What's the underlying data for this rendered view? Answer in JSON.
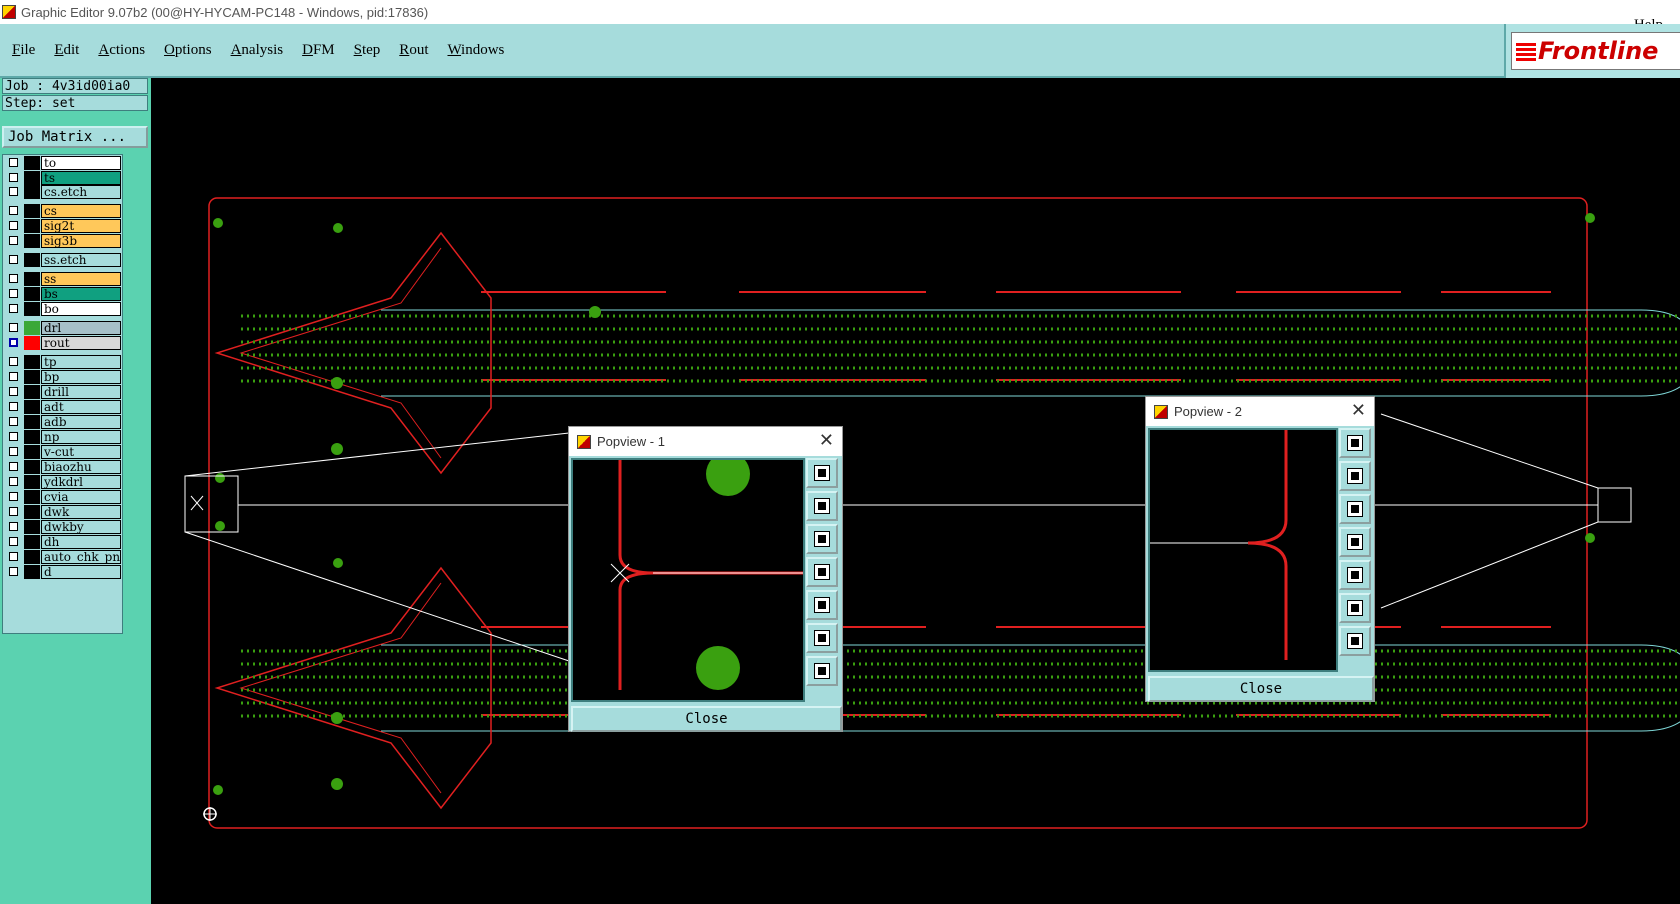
{
  "window": {
    "title": "Graphic Editor 9.07b2 (00@HY-HYCAM-PC148 - Windows, pid:17836)"
  },
  "menu": {
    "items": [
      {
        "first": "F",
        "rest": "ile"
      },
      {
        "first": "E",
        "rest": "dit"
      },
      {
        "first": "A",
        "rest": "ctions"
      },
      {
        "first": "O",
        "rest": "ptions"
      },
      {
        "first": "A",
        "rest": "nalysis"
      },
      {
        "first": "D",
        "rest": "FM"
      },
      {
        "first": "S",
        "rest": "tep"
      },
      {
        "first": "R",
        "rest": "out"
      },
      {
        "first": "W",
        "rest": "indows"
      }
    ],
    "help": "Help"
  },
  "logo": {
    "text": "Frontline",
    "brand_color": "#cc0000"
  },
  "job_info": {
    "job": "Job : 4v3id00ia0",
    "step": "Step: set",
    "job_matrix_label": "Job Matrix ..."
  },
  "layers": [
    {
      "name": "to",
      "color": "#ffffff",
      "swatch": "#000000",
      "checked": false
    },
    {
      "name": "ts",
      "color": "#10a080",
      "swatch": "#000000",
      "checked": false
    },
    {
      "name": "cs.etch",
      "color": "#a6dcdc",
      "swatch": "#000000",
      "checked": false
    },
    {
      "name": "cs",
      "color": "#ffc85a",
      "swatch": "#000000",
      "checked": false
    },
    {
      "name": "sig2t",
      "color": "#ffc85a",
      "swatch": "#000000",
      "checked": false
    },
    {
      "name": "sig3b",
      "color": "#ffc85a",
      "swatch": "#000000",
      "checked": false
    },
    {
      "name": "ss.etch",
      "color": "#a6dcdc",
      "swatch": "#000000",
      "checked": false
    },
    {
      "name": "ss",
      "color": "#ffc85a",
      "swatch": "#000000",
      "checked": false
    },
    {
      "name": "bs",
      "color": "#10a080",
      "swatch": "#000000",
      "checked": false
    },
    {
      "name": "bo",
      "color": "#ffffff",
      "swatch": "#000000",
      "checked": false
    },
    {
      "name": "drl",
      "color": "#a6c0c8",
      "swatch": "#3aa838",
      "checked": false
    },
    {
      "name": "rout",
      "color": "#d8d8d8",
      "swatch": "#ff0000",
      "checked": true
    },
    {
      "name": "tp",
      "color": "#a6dcdc",
      "swatch": "#000000",
      "checked": false
    },
    {
      "name": "bp",
      "color": "#a6dcdc",
      "swatch": "#000000",
      "checked": false
    },
    {
      "name": "drill",
      "color": "#a6dcdc",
      "swatch": "#000000",
      "checked": false
    },
    {
      "name": "adt",
      "color": "#a6dcdc",
      "swatch": "#000000",
      "checked": false
    },
    {
      "name": "adb",
      "color": "#a6dcdc",
      "swatch": "#000000",
      "checked": false
    },
    {
      "name": "np",
      "color": "#a6dcdc",
      "swatch": "#000000",
      "checked": false
    },
    {
      "name": "v-cut",
      "color": "#a6dcdc",
      "swatch": "#000000",
      "checked": false
    },
    {
      "name": "biaozhu",
      "color": "#a6dcdc",
      "swatch": "#000000",
      "checked": false
    },
    {
      "name": "ydkdrl",
      "color": "#a6dcdc",
      "swatch": "#000000",
      "checked": false
    },
    {
      "name": "cvia",
      "color": "#a6dcdc",
      "swatch": "#000000",
      "checked": false
    },
    {
      "name": "dwk",
      "color": "#a6dcdc",
      "swatch": "#000000",
      "checked": false
    },
    {
      "name": "dwkby",
      "color": "#a6dcdc",
      "swatch": "#000000",
      "checked": false
    },
    {
      "name": "dh",
      "color": "#a6dcdc",
      "swatch": "#000000",
      "checked": false
    },
    {
      "name": "auto_chk_pn",
      "color": "#a6dcdc",
      "swatch": "#000000",
      "checked": false
    },
    {
      "name": "d",
      "color": "#a6dcdc",
      "swatch": "#000000",
      "checked": false
    }
  ],
  "popviews": [
    {
      "title": "Popview - 1",
      "close_label": "Close",
      "close_x": "✕"
    },
    {
      "title": "Popview - 2",
      "close_label": "Close",
      "close_x": "✕"
    }
  ],
  "colors": {
    "rout_line": "#e02020",
    "profile_line": "#7fd8d8",
    "pad_green": "#3aa010",
    "panel_bg": "#a6dcdc"
  }
}
